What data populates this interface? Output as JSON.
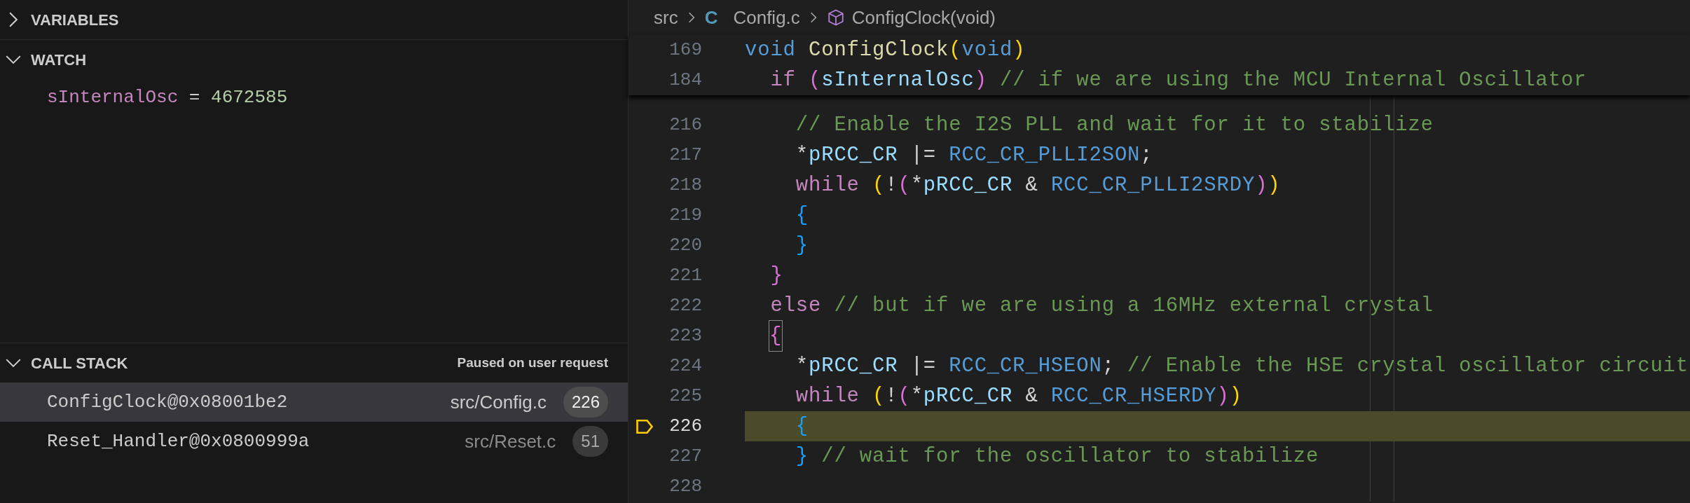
{
  "variables": {
    "title": "VARIABLES",
    "expanded": false
  },
  "watch": {
    "title": "WATCH",
    "expanded": true,
    "items": [
      {
        "name": "sInternalOsc",
        "separator": "=",
        "value": "4672585"
      }
    ]
  },
  "call_stack": {
    "title": "CALL STACK",
    "expanded": true,
    "status": "Paused on user request",
    "frames": [
      {
        "name": "ConfigClock@0x08001be2",
        "file": "src/Config.c",
        "line": "226",
        "selected": true
      },
      {
        "name": "Reset_Handler@0x0800999a",
        "file": "src/Reset.c",
        "line": "51",
        "selected": false
      }
    ]
  },
  "breadcrumbs": [
    {
      "kind": "folder",
      "text": "src"
    },
    {
      "kind": "c-file",
      "icon": "C",
      "text": "Config.c"
    },
    {
      "kind": "function",
      "text": "ConfigClock(void)"
    }
  ],
  "sticky_lines": [
    {
      "number": "169",
      "tokens": [
        {
          "text": "void",
          "kind": "kw"
        },
        {
          "text": " ConfigClock",
          "kind": "fn"
        },
        {
          "text": "(",
          "kind": "b1"
        },
        {
          "text": "void",
          "kind": "kw"
        },
        {
          "text": ")",
          "kind": "b1"
        }
      ]
    },
    {
      "number": "184",
      "tokens": [
        {
          "text": "  if",
          "kind": "ctrl"
        },
        {
          "text": " (",
          "kind": "b2"
        },
        {
          "text": "sInternalOsc",
          "kind": "var"
        },
        {
          "text": ")",
          "kind": "b2"
        },
        {
          "text": " // if we are using the MCU Internal Oscillator",
          "kind": "cmt"
        }
      ]
    }
  ],
  "lines": [
    {
      "number": "216",
      "current": false,
      "tokens": [
        {
          "text": "    // Enable the I2S PLL and wait for it to stabilize",
          "kind": "cmt"
        }
      ]
    },
    {
      "number": "217",
      "current": false,
      "tokens": [
        {
          "text": "    *",
          "kind": "op"
        },
        {
          "text": "pRCC_CR",
          "kind": "var"
        },
        {
          "text": " |= ",
          "kind": "op"
        },
        {
          "text": "RCC_CR_PLLI2SON",
          "kind": "const"
        },
        {
          "text": ";",
          "kind": "op"
        }
      ]
    },
    {
      "number": "218",
      "current": false,
      "tokens": [
        {
          "text": "    while",
          "kind": "ctrl"
        },
        {
          "text": " (",
          "kind": "b1"
        },
        {
          "text": "!",
          "kind": "op"
        },
        {
          "text": "(",
          "kind": "b2"
        },
        {
          "text": "*",
          "kind": "op"
        },
        {
          "text": "pRCC_CR",
          "kind": "var"
        },
        {
          "text": " & ",
          "kind": "op"
        },
        {
          "text": "RCC_CR_PLLI2SRDY",
          "kind": "const"
        },
        {
          "text": ")",
          "kind": "b2"
        },
        {
          "text": ")",
          "kind": "b1"
        }
      ]
    },
    {
      "number": "219",
      "current": false,
      "tokens": [
        {
          "text": "    {",
          "kind": "b3"
        }
      ]
    },
    {
      "number": "220",
      "current": false,
      "tokens": [
        {
          "text": "    }",
          "kind": "b3"
        }
      ]
    },
    {
      "number": "221",
      "current": false,
      "tokens": [
        {
          "text": "  }",
          "kind": "b2"
        }
      ]
    },
    {
      "number": "222",
      "current": false,
      "tokens": [
        {
          "text": "  else",
          "kind": "ctrl"
        },
        {
          "text": " // but if we are using a 16MHz external crystal",
          "kind": "cmt"
        }
      ]
    },
    {
      "number": "223",
      "current": false,
      "tokens": [
        {
          "text": "{",
          "kind": "b2m"
        }
      ]
    },
    {
      "number": "224",
      "current": false,
      "tokens": [
        {
          "text": "    *",
          "kind": "op"
        },
        {
          "text": "pRCC_CR",
          "kind": "var"
        },
        {
          "text": " |= ",
          "kind": "op"
        },
        {
          "text": "RCC_CR_HSEON",
          "kind": "const"
        },
        {
          "text": ";",
          "kind": "op"
        },
        {
          "text": " // Enable the HSE crystal oscillator circuit",
          "kind": "cmt"
        }
      ]
    },
    {
      "number": "225",
      "current": false,
      "tokens": [
        {
          "text": "    while",
          "kind": "ctrl"
        },
        {
          "text": " (",
          "kind": "b1"
        },
        {
          "text": "!",
          "kind": "op"
        },
        {
          "text": "(",
          "kind": "b2"
        },
        {
          "text": "*",
          "kind": "op"
        },
        {
          "text": "pRCC_CR",
          "kind": "var"
        },
        {
          "text": " & ",
          "kind": "op"
        },
        {
          "text": "RCC_CR_HSERDY",
          "kind": "const"
        },
        {
          "text": ")",
          "kind": "b2"
        },
        {
          "text": ")",
          "kind": "b1"
        }
      ]
    },
    {
      "number": "226",
      "current": true,
      "tokens": [
        {
          "text": "    {",
          "kind": "b3"
        }
      ]
    },
    {
      "number": "227",
      "current": false,
      "tokens": [
        {
          "text": "    }",
          "kind": "b3"
        },
        {
          "text": " // wait for the oscillator to stabilize",
          "kind": "cmt"
        }
      ]
    },
    {
      "number": "228",
      "current": false
    }
  ]
}
